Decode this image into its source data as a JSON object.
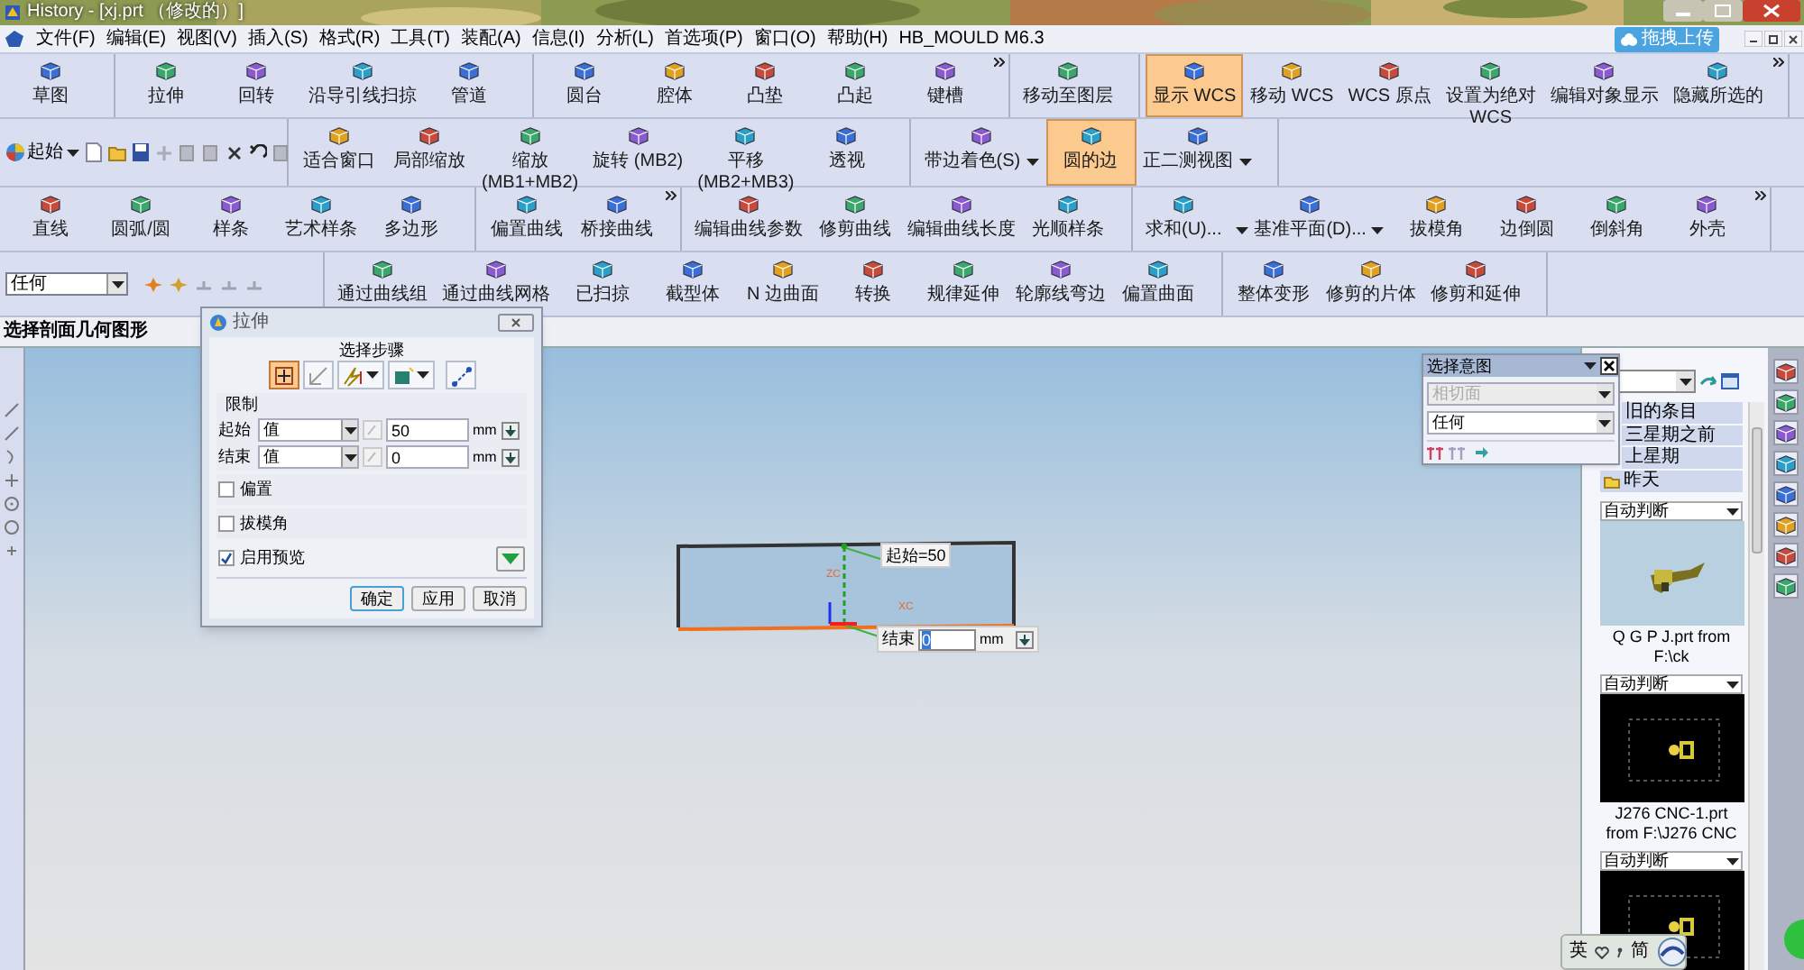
{
  "window": {
    "title": "History - [xj.prt （修改的）]"
  },
  "upload_button": {
    "label": "拖拽上传"
  },
  "menu": [
    "文件(F)",
    "编辑(E)",
    "视图(V)",
    "插入(S)",
    "格式(R)",
    "工具(T)",
    "装配(A)",
    "信息(I)",
    "分析(L)",
    "首选项(P)",
    "窗口(O)",
    "帮助(H)",
    "HB_MOULD M6.3"
  ],
  "toolbar_rows": [
    {
      "groups": [
        {
          "more": false,
          "buttons": [
            {
              "label": "草图",
              "kind": "button",
              "selected": false
            }
          ]
        },
        {
          "more": false,
          "buttons": [
            {
              "label": "拉伸",
              "kind": "button",
              "selected": false
            },
            {
              "label": "回转",
              "kind": "button",
              "selected": false
            },
            {
              "label": "沿导引线扫掠",
              "kind": "button",
              "selected": false
            },
            {
              "label": "管道",
              "kind": "button",
              "selected": false
            }
          ]
        },
        {
          "more": true,
          "buttons": [
            {
              "label": "圆台",
              "kind": "button",
              "selected": false
            },
            {
              "label": "腔体",
              "kind": "button",
              "selected": false
            },
            {
              "label": "凸垫",
              "kind": "button",
              "selected": false
            },
            {
              "label": "凸起",
              "kind": "button",
              "selected": false
            },
            {
              "label": "键槽",
              "kind": "button",
              "selected": false
            }
          ]
        },
        {
          "more": false,
          "buttons": [
            {
              "label": "移动至图层",
              "kind": "button",
              "selected": false
            }
          ]
        },
        {
          "more": true,
          "buttons": [
            {
              "label": "显示 WCS",
              "kind": "button",
              "selected": true
            },
            {
              "label": "移动 WCS",
              "kind": "button",
              "selected": false
            },
            {
              "label": "WCS 原点",
              "kind": "button",
              "selected": false
            },
            {
              "label": "设置为绝对\nWCS",
              "kind": "button",
              "selected": false
            },
            {
              "label": "编辑对象显示",
              "kind": "button",
              "selected": false
            },
            {
              "label": "隐藏所选的",
              "kind": "button",
              "selected": false
            }
          ]
        }
      ]
    },
    {
      "lead": {
        "kind": "start",
        "label": "起始"
      },
      "groups": [
        {
          "more": false,
          "buttons": [
            {
              "label": "适合窗口",
              "kind": "button",
              "selected": false
            },
            {
              "label": "局部缩放",
              "kind": "button",
              "selected": false
            },
            {
              "label": "缩放\n(MB1+MB2)",
              "kind": "button",
              "selected": false
            },
            {
              "label": "旋转 (MB2)",
              "kind": "button",
              "selected": false
            },
            {
              "label": "平移\n(MB2+MB3)",
              "kind": "button",
              "selected": false
            },
            {
              "label": "透视",
              "kind": "button",
              "selected": false
            }
          ]
        },
        {
          "more": false,
          "buttons": [
            {
              "label": "带边着色(S)",
              "kind": "dropdown",
              "selected": false
            },
            {
              "label": "圆的边",
              "kind": "button",
              "selected": true
            },
            {
              "label": "正二测视图",
              "kind": "dropdown",
              "selected": false
            }
          ]
        }
      ]
    },
    {
      "groups": [
        {
          "more": false,
          "buttons": [
            {
              "label": "直线",
              "kind": "button",
              "selected": false
            },
            {
              "label": "圆弧/圆",
              "kind": "button",
              "selected": false
            },
            {
              "label": "样条",
              "kind": "button",
              "selected": false
            },
            {
              "label": "艺术样条",
              "kind": "button",
              "selected": false
            },
            {
              "label": "多边形",
              "kind": "button",
              "selected": false
            }
          ]
        },
        {
          "more": true,
          "buttons": [
            {
              "label": "偏置曲线",
              "kind": "button",
              "selected": false
            },
            {
              "label": "桥接曲线",
              "kind": "button",
              "selected": false
            }
          ]
        },
        {
          "more": false,
          "buttons": [
            {
              "label": "编辑曲线参数",
              "kind": "button",
              "selected": false
            },
            {
              "label": "修剪曲线",
              "kind": "button",
              "selected": false
            },
            {
              "label": "编辑曲线长度",
              "kind": "button",
              "selected": false
            },
            {
              "label": "光顺样条",
              "kind": "button",
              "selected": false
            }
          ]
        },
        {
          "more": true,
          "buttons": [
            {
              "label": "求和(U)...",
              "kind": "button",
              "selected": false
            },
            {
              "label": "基准平面(D)...",
              "kind": "split",
              "selected": false
            },
            {
              "label": "拔模角",
              "kind": "button",
              "selected": false
            },
            {
              "label": "边倒圆",
              "kind": "button",
              "selected": false
            },
            {
              "label": "倒斜角",
              "kind": "button",
              "selected": false
            },
            {
              "label": "外壳",
              "kind": "button",
              "selected": false
            }
          ]
        }
      ]
    },
    {
      "lead": {
        "kind": "filter",
        "label": "任何"
      },
      "groups": [
        {
          "more": false,
          "buttons": [
            {
              "label": "通过曲线组",
              "kind": "button",
              "selected": false
            },
            {
              "label": "通过曲线网格",
              "kind": "button",
              "selected": false
            },
            {
              "label": "已扫掠",
              "kind": "button",
              "selected": false
            },
            {
              "label": "截型体",
              "kind": "button",
              "selected": false
            },
            {
              "label": "N 边曲面",
              "kind": "button",
              "selected": false
            },
            {
              "label": "转换",
              "kind": "button",
              "selected": false
            },
            {
              "label": "规律延伸",
              "kind": "button",
              "selected": false
            },
            {
              "label": "轮廓线弯边",
              "kind": "button",
              "selected": false
            },
            {
              "label": "偏置曲面",
              "kind": "button",
              "selected": false
            }
          ]
        },
        {
          "more": false,
          "buttons": [
            {
              "label": "整体变形",
              "kind": "button",
              "selected": false
            },
            {
              "label": "修剪的片体",
              "kind": "button",
              "selected": false
            },
            {
              "label": "修剪和延伸",
              "kind": "button",
              "selected": false
            }
          ]
        }
      ]
    }
  ],
  "prompt": "选择剖面几何图形",
  "dialog": {
    "title": "拉伸",
    "steps_label": "选择步骤",
    "steps": [
      {
        "selected": true,
        "dropdown": false
      },
      {
        "selected": false,
        "dropdown": false
      },
      {
        "selected": false,
        "dropdown": true
      },
      {
        "selected": false,
        "dropdown": true
      },
      {
        "selected": false,
        "dropdown": false
      }
    ],
    "limits_label": "限制",
    "limits": [
      {
        "label": "起始",
        "mode": "值",
        "value": "50",
        "unit": "mm"
      },
      {
        "label": "结束",
        "mode": "值",
        "value": "0",
        "unit": "mm"
      }
    ],
    "options": [
      {
        "label": "偏置",
        "checked": false
      },
      {
        "label": "拔模角",
        "checked": false
      },
      {
        "label": "启用预览",
        "checked": true
      }
    ],
    "buttons": [
      {
        "label": "确定",
        "default": true
      },
      {
        "label": "应用",
        "default": false
      },
      {
        "label": "取消",
        "default": false
      }
    ]
  },
  "viewport": {
    "start_label": "起始=50",
    "end_label": "结束",
    "end_value": "0",
    "end_unit": "mm",
    "axis_labels": [
      "ZC",
      "XC"
    ]
  },
  "selection_intent": {
    "title": "选择意图",
    "rule": "相切面",
    "filter": "任何"
  },
  "history_palette": {
    "groups": [
      "旧的条目",
      "三星期之前",
      "上星期",
      "昨天"
    ],
    "items": [
      {
        "filter": "自动判断",
        "kind": "light",
        "caption": "Q G P J.prt from\nF:\\ck"
      },
      {
        "filter": "自动判断",
        "kind": "dark",
        "caption": "J276 CNC-1.prt\nfrom F:\\J276 CNC"
      },
      {
        "filter": "自动判断",
        "kind": "dark"
      }
    ]
  },
  "ime": {
    "language": "英",
    "script": "简"
  }
}
